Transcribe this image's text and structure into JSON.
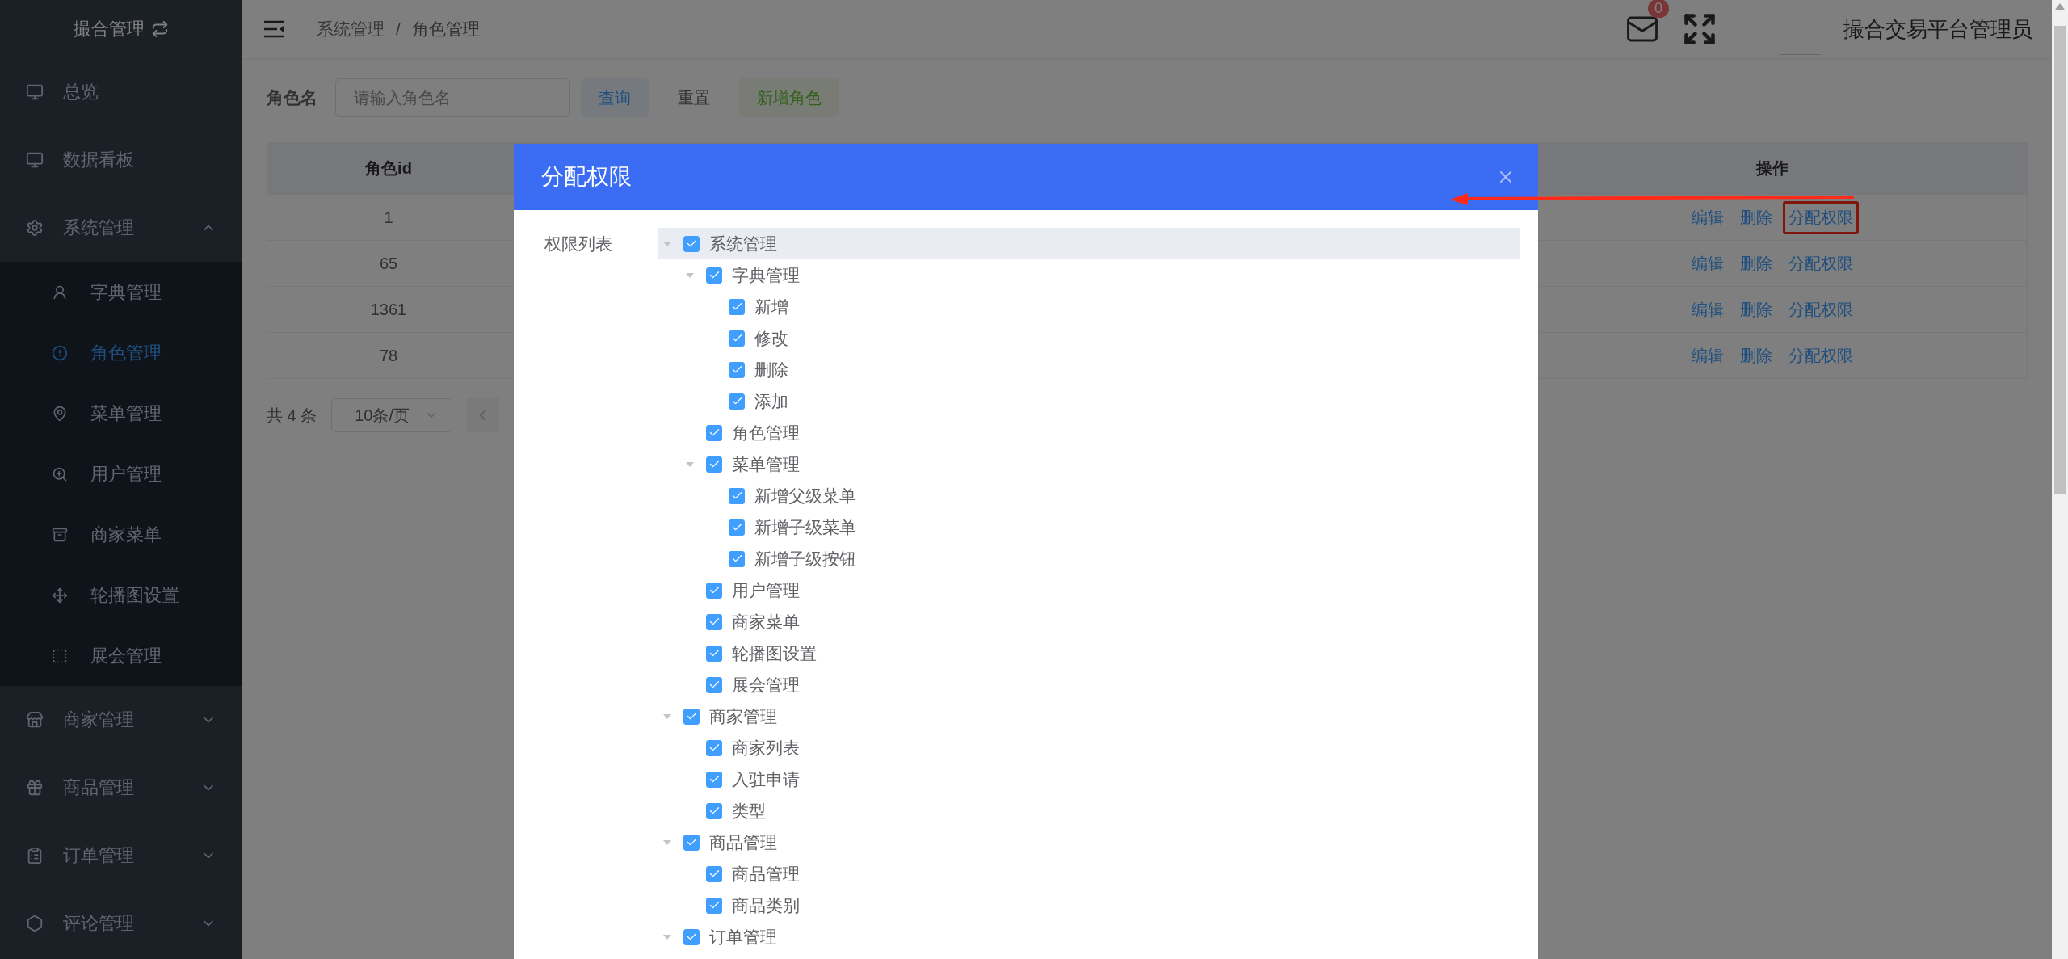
{
  "sidebar": {
    "title": "撮合管理",
    "items": [
      {
        "label": "总览",
        "selected": false
      },
      {
        "label": "数据看板",
        "selected": false
      },
      {
        "label": "系统管理",
        "selected": false,
        "expanded": true,
        "children": [
          {
            "label": "字典管理",
            "selected": false
          },
          {
            "label": "角色管理",
            "selected": true
          },
          {
            "label": "菜单管理",
            "selected": false
          },
          {
            "label": "用户管理",
            "selected": false
          },
          {
            "label": "商家菜单",
            "selected": false
          },
          {
            "label": "轮播图设置",
            "selected": false
          },
          {
            "label": "展会管理",
            "selected": false
          }
        ]
      },
      {
        "label": "商家管理",
        "selected": false,
        "expanded": false
      },
      {
        "label": "商品管理",
        "selected": false,
        "expanded": false
      },
      {
        "label": "订单管理",
        "selected": false,
        "expanded": false
      },
      {
        "label": "评论管理",
        "selected": false,
        "expanded": false
      }
    ]
  },
  "header": {
    "breadcrumb": [
      "系统管理",
      "角色管理"
    ],
    "separator": "/",
    "mail_badge": "0",
    "user_name": "撮合交易平台管理员"
  },
  "search": {
    "label": "角色名",
    "placeholder": "请输入角色名",
    "buttons": [
      {
        "label": "查询",
        "kind": "primary"
      },
      {
        "label": "重置",
        "kind": "plain"
      },
      {
        "label": "新增角色",
        "kind": "success"
      }
    ]
  },
  "table": {
    "columns": [
      "角色id",
      "操作"
    ],
    "rows": [
      {
        "id": "1",
        "actions": [
          {
            "label": "编辑",
            "highlighted": false
          },
          {
            "label": "删除",
            "highlighted": false
          },
          {
            "label": "分配权限",
            "highlighted": true
          }
        ]
      },
      {
        "id": "65",
        "actions": [
          {
            "label": "编辑",
            "highlighted": false
          },
          {
            "label": "删除",
            "highlighted": false
          },
          {
            "label": "分配权限",
            "highlighted": false
          }
        ]
      },
      {
        "id": "1361",
        "actions": [
          {
            "label": "编辑",
            "highlighted": false
          },
          {
            "label": "删除",
            "highlighted": false
          },
          {
            "label": "分配权限",
            "highlighted": false
          }
        ]
      },
      {
        "id": "78",
        "actions": [
          {
            "label": "编辑",
            "highlighted": false
          },
          {
            "label": "删除",
            "highlighted": false
          },
          {
            "label": "分配权限",
            "highlighted": false
          }
        ]
      }
    ]
  },
  "pagination": {
    "total": "共 4 条",
    "page_size": "10条/页"
  },
  "dialog": {
    "title": "分配权限",
    "field_label": "权限列表",
    "tree": [
      {
        "label": "系统管理",
        "checked": true,
        "expanded": true,
        "highlighted": true,
        "children": [
          {
            "label": "字典管理",
            "checked": true,
            "expanded": true,
            "highlighted": false,
            "children": [
              {
                "label": "新增",
                "checked": true,
                "highlighted": false
              },
              {
                "label": "修改",
                "checked": true,
                "highlighted": false
              },
              {
                "label": "删除",
                "checked": true,
                "highlighted": false
              },
              {
                "label": "添加",
                "checked": true,
                "highlighted": false
              }
            ]
          },
          {
            "label": "角色管理",
            "checked": true,
            "highlighted": false
          },
          {
            "label": "菜单管理",
            "checked": true,
            "expanded": true,
            "highlighted": false,
            "children": [
              {
                "label": "新增父级菜单",
                "checked": true,
                "highlighted": false
              },
              {
                "label": "新增子级菜单",
                "checked": true,
                "highlighted": false
              },
              {
                "label": "新增子级按钮",
                "checked": true,
                "highlighted": false
              }
            ]
          },
          {
            "label": "用户管理",
            "checked": true,
            "highlighted": false
          },
          {
            "label": "商家菜单",
            "checked": true,
            "highlighted": false
          },
          {
            "label": "轮播图设置",
            "checked": true,
            "highlighted": false
          },
          {
            "label": "展会管理",
            "checked": true,
            "highlighted": false
          }
        ]
      },
      {
        "label": "商家管理",
        "checked": true,
        "expanded": true,
        "highlighted": false,
        "children": [
          {
            "label": "商家列表",
            "checked": true,
            "highlighted": false
          },
          {
            "label": "入驻申请",
            "checked": true,
            "highlighted": false
          },
          {
            "label": "类型",
            "checked": true,
            "highlighted": false
          }
        ]
      },
      {
        "label": "商品管理",
        "checked": true,
        "expanded": true,
        "highlighted": false,
        "children": [
          {
            "label": "商品管理",
            "checked": true,
            "highlighted": false
          },
          {
            "label": "商品类别",
            "checked": true,
            "highlighted": false
          }
        ]
      },
      {
        "label": "订单管理",
        "checked": true,
        "expanded": true,
        "highlighted": false
      }
    ]
  }
}
